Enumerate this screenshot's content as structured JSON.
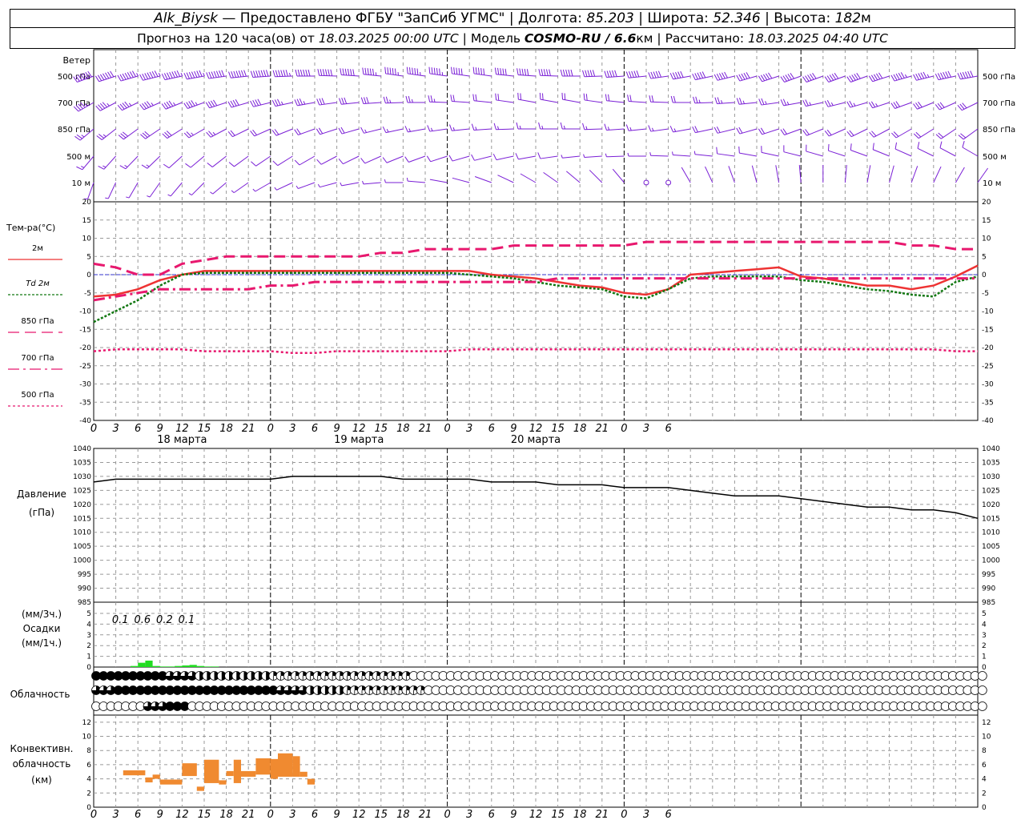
{
  "header": {
    "station": "Alk_Biysk",
    "provider": "— Предоставлено ФГБУ \"ЗапСиб УГМС\"",
    "lon_label": "Долгота:",
    "lon": "85.203",
    "lat_label": "Широта:",
    "lat": "52.346",
    "alt_label": "Высота:",
    "alt": "182",
    "alt_unit": "м",
    "forecast_label": "Прогноз на 120 часа(ов) от",
    "start": "18.03.2025 00:00 UTC",
    "model_label": "Модель",
    "model": "COSMO-RU / 6.6",
    "model_unit": "км",
    "calc_label": "Рассчитано:",
    "calc": "18.03.2025 04:40 UTC",
    "sep": "|"
  },
  "colors": {
    "wind": "#7a1fd6",
    "t2m": "#ee3333",
    "td2m": "#117711",
    "t850": "#e8186e",
    "t700": "#e8186e",
    "t500": "#e8186e",
    "zero": "#3333cc",
    "precip": "#22dd22",
    "conv": "#f08a30",
    "pressure": "#000000"
  },
  "chart_data": [
    {
      "type": "wind_barbs",
      "panel_label": "Ветер",
      "levels": [
        "500 гПа",
        "700 гПа",
        "850 гПа",
        "500 м",
        "10 м"
      ],
      "hours": [
        0,
        3,
        6,
        9,
        12,
        15,
        18,
        21,
        24,
        27,
        30,
        33,
        36,
        39,
        42,
        45,
        48,
        51,
        54,
        57,
        60,
        63,
        66,
        69,
        72,
        75,
        78,
        81,
        84,
        87,
        90,
        93,
        96,
        99,
        102,
        105,
        108,
        111,
        114,
        117,
        120
      ],
      "speed_ms": {
        "500 гПа": [
          35,
          36,
          37,
          38,
          38,
          37,
          36,
          35,
          34,
          33,
          31,
          30,
          29,
          28,
          28,
          27,
          27,
          26,
          26,
          25,
          25,
          25,
          25,
          25,
          25,
          25,
          25,
          25,
          25,
          25,
          25,
          25,
          25,
          25,
          25,
          26,
          26,
          27,
          28,
          29,
          30
        ],
        "700 гПа": [
          22,
          22,
          23,
          23,
          23,
          22,
          21,
          20,
          19,
          18,
          17,
          16,
          15,
          14,
          13,
          12,
          12,
          11,
          11,
          10,
          10,
          10,
          10,
          10,
          10,
          11,
          11,
          11,
          12,
          12,
          12,
          12,
          12,
          13,
          13,
          13,
          13,
          14,
          14,
          15,
          15
        ],
        "850 гПа": [
          13,
          13,
          14,
          14,
          14,
          13,
          12,
          11,
          10,
          10,
          9,
          9,
          9,
          8,
          8,
          8,
          8,
          8,
          8,
          8,
          8,
          8,
          8,
          8,
          8,
          8,
          8,
          8,
          9,
          9,
          9,
          9,
          9,
          9,
          10,
          10,
          10,
          10,
          11,
          11,
          11
        ],
        "500 м": [
          8,
          8,
          7,
          7,
          6,
          6,
          5,
          5,
          5,
          5,
          5,
          5,
          4,
          4,
          4,
          4,
          4,
          4,
          4,
          4,
          4,
          4,
          3,
          3,
          3,
          3,
          3,
          3,
          3,
          4,
          4,
          4,
          4,
          4,
          4,
          5,
          5,
          5,
          5,
          5,
          5
        ],
        "10 м": [
          3,
          3,
          3,
          2,
          2,
          2,
          2,
          2,
          2,
          2,
          2,
          2,
          2,
          2,
          2,
          2,
          1,
          1,
          1,
          1,
          1,
          1,
          1,
          1,
          1,
          0,
          0,
          1,
          1,
          1,
          1,
          1,
          1,
          1,
          1,
          1,
          1,
          1,
          1,
          1,
          1
        ]
      },
      "dir_deg": {
        "500 гПа": [
          250,
          252,
          254,
          256,
          258,
          260,
          262,
          264,
          266,
          268,
          270,
          272,
          274,
          276,
          278,
          278,
          278,
          278,
          278,
          276,
          274,
          272,
          270,
          268,
          266,
          264,
          262,
          260,
          258,
          256,
          254,
          252,
          250,
          250,
          250,
          250,
          252,
          254,
          256,
          258,
          260
        ],
        "700 гПа": [
          240,
          242,
          244,
          246,
          248,
          250,
          252,
          254,
          256,
          258,
          260,
          262,
          264,
          266,
          268,
          270,
          272,
          274,
          276,
          278,
          280,
          280,
          280,
          278,
          276,
          274,
          272,
          270,
          268,
          266,
          264,
          262,
          260,
          258,
          256,
          254,
          252,
          250,
          248,
          246,
          244
        ],
        "850 гПа": [
          230,
          232,
          234,
          236,
          238,
          240,
          242,
          244,
          246,
          248,
          250,
          252,
          254,
          256,
          258,
          260,
          262,
          264,
          266,
          268,
          270,
          270,
          270,
          268,
          266,
          264,
          262,
          260,
          258,
          256,
          254,
          252,
          250,
          248,
          246,
          244,
          242,
          240,
          238,
          236,
          234
        ],
        "500 м": [
          220,
          222,
          224,
          226,
          228,
          230,
          232,
          234,
          236,
          238,
          240,
          242,
          244,
          246,
          248,
          250,
          252,
          254,
          256,
          258,
          260,
          262,
          264,
          266,
          268,
          270,
          272,
          274,
          276,
          278,
          280,
          282,
          284,
          286,
          288,
          290,
          292,
          294,
          296,
          298,
          300
        ],
        "10 м": [
          200,
          205,
          210,
          215,
          220,
          225,
          230,
          235,
          240,
          245,
          250,
          255,
          260,
          265,
          270,
          275,
          280,
          285,
          290,
          295,
          300,
          305,
          310,
          315,
          320,
          0,
          0,
          330,
          335,
          340,
          345,
          350,
          355,
          0,
          5,
          10,
          15,
          20,
          25,
          30,
          35
        ]
      }
    },
    {
      "type": "line",
      "panel_label": "Тем-ра(°C)",
      "x": [
        0,
        3,
        6,
        9,
        12,
        15,
        18,
        21,
        24,
        27,
        30,
        33,
        36,
        39,
        42,
        45,
        48,
        51,
        54,
        57,
        60,
        63,
        66,
        69,
        72,
        75,
        78,
        81,
        84,
        87,
        90,
        93,
        96,
        99,
        102,
        105,
        108,
        111,
        114,
        117,
        120
      ],
      "ylim": [
        -40,
        20
      ],
      "yticks": [
        20,
        15,
        10,
        5,
        0,
        -5,
        -10,
        -15,
        -20,
        -25,
        -30,
        -35,
        -40
      ],
      "series": [
        {
          "name": "2м",
          "style": "solid",
          "values": [
            -6,
            -5.5,
            -4,
            -1.5,
            0,
            1,
            1,
            1,
            1,
            1,
            1,
            1,
            1,
            1,
            1,
            1,
            1,
            1,
            0,
            -0.5,
            -1,
            -2,
            -3,
            -3.5,
            -5,
            -5.5,
            -4,
            0,
            0.5,
            1,
            1.5,
            2,
            -0.5,
            -1,
            -2,
            -3,
            -3,
            -4,
            -3,
            -0.5,
            2.5
          ]
        },
        {
          "name": "Td 2м",
          "style": "dotted",
          "values": [
            -13,
            -10,
            -7,
            -3,
            0,
            0.5,
            0.5,
            0.5,
            0.5,
            0.5,
            0.5,
            0.5,
            0.5,
            0.5,
            0.5,
            0.5,
            0.5,
            0,
            -0.5,
            -1,
            -2,
            -3,
            -3.5,
            -4,
            -6,
            -6.5,
            -4,
            -1,
            -0.5,
            -0.5,
            -0.5,
            -0.5,
            -1.5,
            -2,
            -3,
            -4,
            -4.5,
            -5.5,
            -6,
            -2,
            -0.5
          ]
        },
        {
          "name": "850 гПа",
          "style": "longdash",
          "values": [
            3,
            2,
            0,
            0,
            3,
            4,
            5,
            5,
            5,
            5,
            5,
            5,
            5,
            6,
            6,
            7,
            7,
            7,
            7,
            8,
            8,
            8,
            8,
            8,
            8,
            9,
            9,
            9,
            9,
            9,
            9,
            9,
            9,
            9,
            9,
            9,
            9,
            8,
            8,
            7,
            7
          ]
        },
        {
          "name": "700 гПа",
          "style": "dashdot",
          "values": [
            -7,
            -6,
            -5,
            -4,
            -4,
            -4,
            -4,
            -4,
            -3,
            -3,
            -2,
            -2,
            -2,
            -2,
            -2,
            -2,
            -2,
            -2,
            -2,
            -2,
            -2,
            -1,
            -1,
            -1,
            -1,
            -1,
            -1,
            -1,
            -1,
            -1,
            -1,
            -1,
            -1,
            -1,
            -1,
            -1,
            -1,
            -1,
            -1,
            -1,
            -1
          ]
        },
        {
          "name": "500 гПа",
          "style": "shortdash",
          "values": [
            -21,
            -20.5,
            -20.5,
            -20.5,
            -20.5,
            -21,
            -21,
            -21,
            -21,
            -21.5,
            -21.5,
            -21,
            -21,
            -21,
            -21,
            -21,
            -21,
            -20.5,
            -20.5,
            -20.5,
            -20.5,
            -20.5,
            -20.5,
            -20.5,
            -20.5,
            -20.5,
            -20.5,
            -20.5,
            -20.5,
            -20.5,
            -20.5,
            -20.5,
            -20.5,
            -20.5,
            -20.5,
            -20.5,
            -20.5,
            -20.5,
            -20.5,
            -21,
            -21
          ]
        }
      ],
      "x_ticks": [
        "0",
        "3",
        "6",
        "9",
        "12",
        "15",
        "18",
        "21",
        "0",
        "3",
        "6",
        "9",
        "12",
        "15",
        "18",
        "21",
        "0",
        "3",
        "6",
        "9",
        "12",
        "15",
        "18",
        "21",
        "0",
        "3",
        "6"
      ],
      "day_labels": [
        "18 марта",
        "19 марта",
        "20 марта"
      ]
    },
    {
      "type": "line",
      "panel_label_1": "Давление",
      "panel_label_2": "(гПа)",
      "x": [
        0,
        3,
        6,
        9,
        12,
        15,
        18,
        21,
        24,
        27,
        30,
        33,
        36,
        39,
        42,
        45,
        48,
        51,
        54,
        57,
        60,
        63,
        66,
        69,
        72,
        75,
        78,
        81,
        84,
        87,
        90,
        93,
        96,
        99,
        102,
        105,
        108,
        111,
        114,
        117,
        120
      ],
      "ylim": [
        985,
        1040
      ],
      "yticks": [
        1040,
        1035,
        1030,
        1025,
        1020,
        1015,
        1010,
        1005,
        1000,
        995,
        990,
        985
      ],
      "series": [
        {
          "name": "",
          "values": [
            1028,
            1029,
            1029,
            1029,
            1029,
            1029,
            1029,
            1029,
            1029,
            1030,
            1030,
            1030,
            1030,
            1030,
            1029,
            1029,
            1029,
            1029,
            1028,
            1028,
            1028,
            1027,
            1027,
            1027,
            1026,
            1026,
            1026,
            1025,
            1024,
            1023,
            1023,
            1023,
            1022,
            1021,
            1020,
            1019,
            1019,
            1018,
            1018,
            1017,
            1015
          ]
        }
      ]
    },
    {
      "type": "bar",
      "panel_label_1": "(мм/3ч.)",
      "panel_label_2": "Осадки",
      "panel_label_3": "(мм/1ч.)",
      "ylim": [
        0,
        5
      ],
      "yticks": [
        5,
        4,
        3,
        2,
        1,
        0
      ],
      "hourly_start": 5,
      "hourly_values": [
        0.1,
        0.4,
        0.6,
        0.1,
        0.05,
        0.05,
        0.1,
        0.15,
        0.2,
        0.1,
        0.05,
        0.05
      ],
      "totals_3h": [
        {
          "hour": 6,
          "value": "0.1"
        },
        {
          "hour": 9,
          "value": "0.6"
        },
        {
          "hour": 12,
          "value": "0.2"
        },
        {
          "hour": 15,
          "value": "0.1"
        }
      ]
    },
    {
      "type": "cloud_symbols",
      "panel_label": "Облачность",
      "hours_step": 1,
      "count": 121,
      "rows": [
        {
          "level": "high",
          "pattern": "888888888866664444444444222222222222222222200000000000000000000000000000000000000000000000000000000000000000000000000000000"
        },
        {
          "level": "middle",
          "pattern": "666888888888888888888888866664444422222222222000000000000000000000000000000000000000000000000000000000000000000000000000000"
        },
        {
          "level": "low",
          "pattern": "000000066688800000000000000000000000000000000000000000000000000000000000000000000000000000000000000000000000000000000000000"
        }
      ]
    },
    {
      "type": "bar",
      "panel_label_1": "Конвективн.",
      "panel_label_2": "облачность",
      "panel_label_3": "(км)",
      "ylim": [
        0,
        13
      ],
      "yticks": [
        12,
        10,
        8,
        6,
        4,
        2,
        0
      ],
      "segments": [
        {
          "h0": 4,
          "h1": 7,
          "bottom": 4.5,
          "top": 5.2
        },
        {
          "h0": 7,
          "h1": 8,
          "bottom": 3.5,
          "top": 4.2
        },
        {
          "h0": 8,
          "h1": 9,
          "bottom": 4.0,
          "top": 4.6
        },
        {
          "h0": 9,
          "h1": 12,
          "bottom": 3.2,
          "top": 3.9
        },
        {
          "h0": 12,
          "h1": 14,
          "bottom": 4.4,
          "top": 6.2
        },
        {
          "h0": 14,
          "h1": 15,
          "bottom": 2.3,
          "top": 2.9
        },
        {
          "h0": 15,
          "h1": 17,
          "bottom": 3.4,
          "top": 6.7
        },
        {
          "h0": 17,
          "h1": 18,
          "bottom": 3.2,
          "top": 3.8
        },
        {
          "h0": 18,
          "h1": 19,
          "bottom": 4.4,
          "top": 5.1
        },
        {
          "h0": 19,
          "h1": 20,
          "bottom": 3.4,
          "top": 6.7
        },
        {
          "h0": 20,
          "h1": 22,
          "bottom": 4.3,
          "top": 5.1
        },
        {
          "h0": 22,
          "h1": 24,
          "bottom": 4.6,
          "top": 6.9
        },
        {
          "h0": 24,
          "h1": 25,
          "bottom": 4.0,
          "top": 6.8
        },
        {
          "h0": 25,
          "h1": 27,
          "bottom": 4.3,
          "top": 7.6
        },
        {
          "h0": 27,
          "h1": 28,
          "bottom": 4.3,
          "top": 7.2
        },
        {
          "h0": 28,
          "h1": 29,
          "bottom": 4.3,
          "top": 5.0
        },
        {
          "h0": 29,
          "h1": 30,
          "bottom": 3.2,
          "top": 4.0
        }
      ]
    }
  ]
}
